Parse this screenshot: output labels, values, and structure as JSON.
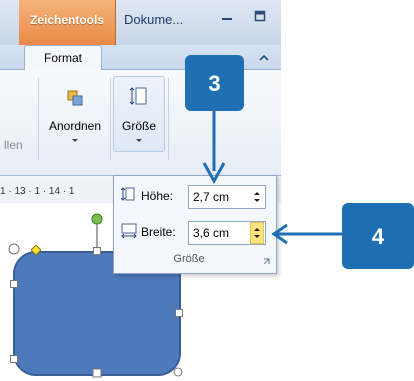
{
  "titlebar": {
    "context_tab": "Zeichentools",
    "document_title": "Dokume..."
  },
  "ribbon": {
    "active_tab": "Format",
    "partial_group_label": "llen",
    "buttons": {
      "arrange": "Anordnen",
      "size": "Größe"
    }
  },
  "ruler": {
    "text": "1 · 13 · 1 · 14 · 1"
  },
  "size_popup": {
    "height_label": "Höhe:",
    "height_value": "2,7 cm",
    "width_label": "Breite:",
    "width_value": "3,6 cm",
    "group_label": "Größe"
  },
  "callouts": {
    "first": "3",
    "second": "4"
  },
  "colors": {
    "callout": "#1f6fb3",
    "shape_fill": "#4e79bb",
    "shape_stroke": "#3a5f97"
  }
}
